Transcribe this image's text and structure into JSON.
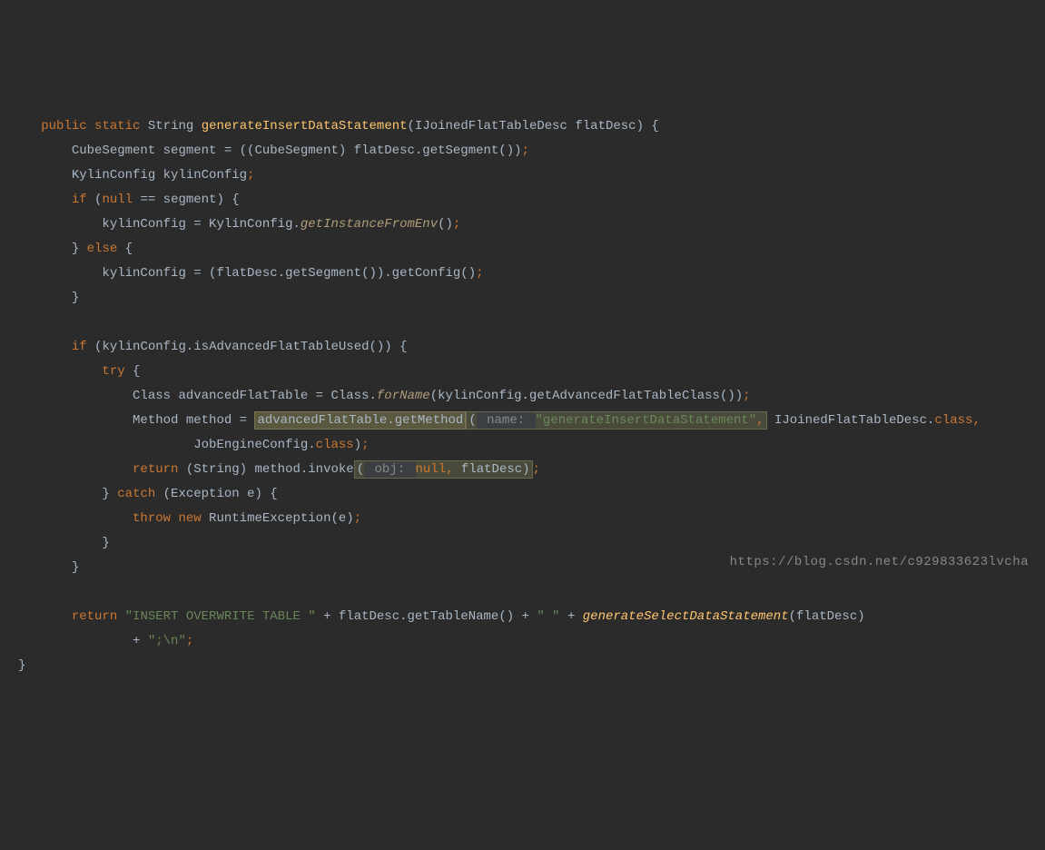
{
  "code": {
    "line1_public": "public",
    "line1_static": "static",
    "line1_String": " String ",
    "line1_method": "generateInsertDataStatement",
    "line1_rest": "(IJoinedFlatTableDesc flatDesc) {",
    "line2": "    CubeSegment segment = ((CubeSegment) flatDesc.getSegment())",
    "line2_semi": ";",
    "line3": "    KylinConfig kylinConfig",
    "line3_semi": ";",
    "line4_if": "    if",
    "line4_null": "null",
    "line4_rest": " == segment) {",
    "line5_a": "        kylinConfig = KylinConfig.",
    "line5_method": "getInstanceFromEnv",
    "line5_b": "()",
    "line5_semi": ";",
    "line6_a": "    } ",
    "line6_else": "else",
    "line6_b": " {",
    "line7": "        kylinConfig = (flatDesc.getSegment()).getConfig()",
    "line7_semi": ";",
    "line8": "    }",
    "line9": "",
    "line10_if": "    if",
    "line10_rest": " (kylinConfig.isAdvancedFlatTableUsed()) {",
    "line11_try": "        try",
    "line11_rest": " {",
    "line12_a": "            Class advancedFlatTable = Class.",
    "line12_method": "forName",
    "line12_b": "(kylinConfig.getAdvancedFlatTableClass())",
    "line12_semi": ";",
    "line13_a": "            Method method = ",
    "line13_hl": "advancedFlatTable.getMethod",
    "line13_paren": "(",
    "line13_hint": " name: ",
    "line13_str": "\"generateInsertDataStatement\"",
    "line13_comma": ",",
    "line13_b": " IJoinedFlatTableDesc.",
    "line13_class": "class",
    "line13_comma2": ",",
    "line14_a": "                    JobEngineConfig.",
    "line14_class": "class",
    "line14_b": ")",
    "line14_semi": ";",
    "line15_return": "            return",
    "line15_a": " (String) method.invoke",
    "line15_paren": "(",
    "line15_hint": " obj: ",
    "line15_null": "null",
    "line15_comma": ",",
    "line15_b": " flatDesc)",
    "line15_semi": ";",
    "line16_a": "        } ",
    "line16_catch": "catch",
    "line16_b": " (Exception e) {",
    "line17_throw": "            throw new",
    "line17_a": " RuntimeException(e)",
    "line17_semi": ";",
    "line18": "        }",
    "line19": "    }",
    "line20": "",
    "line21_return": "    return ",
    "line21_str1": "\"INSERT OVERWRITE TABLE \"",
    "line21_a": " + flatDesc.getTableName() + ",
    "line21_str2": "\" \"",
    "line21_b": " + ",
    "line21_method": "generateSelectDataStatement",
    "line21_c": "(flatDesc)",
    "line22_a": "            + ",
    "line22_str": "\";\\n\"",
    "line22_semi": ";",
    "line23": "}"
  },
  "watermark": "https://blog.csdn.net/c929833623lvcha"
}
